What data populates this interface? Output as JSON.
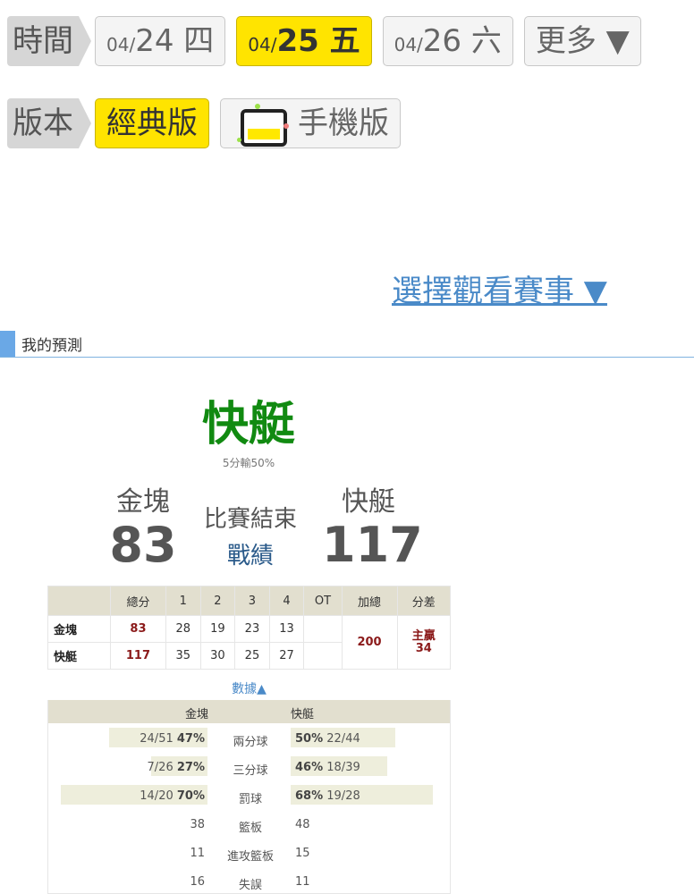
{
  "time_row": {
    "label": "時間",
    "dates": [
      {
        "md": "04/",
        "dd": "24 四",
        "active": false
      },
      {
        "md": "04/",
        "dd": "25 五",
        "active": true
      },
      {
        "md": "04/",
        "dd": "26 六",
        "active": false
      }
    ],
    "more_label": "更多 ▼"
  },
  "version_row": {
    "label": "版本",
    "classic_label": "經典版",
    "mobile_label": "手機版"
  },
  "select_game_label": "選擇觀看賽事 ▼",
  "section": {
    "title": "我的預測"
  },
  "prediction": {
    "team": "快艇",
    "note": "5分輸50%"
  },
  "game": {
    "away": {
      "name": "金塊",
      "score": "83"
    },
    "home": {
      "name": "快艇",
      "score": "117"
    },
    "status": "比賽結束",
    "record_link": "戰績"
  },
  "boxscore": {
    "headers": [
      "",
      "總分",
      "1",
      "2",
      "3",
      "4",
      "OT",
      "加總",
      "分差"
    ],
    "rows": [
      {
        "team": "金塊",
        "total": "83",
        "q": [
          "28",
          "19",
          "23",
          "13"
        ],
        "ot": ""
      },
      {
        "team": "快艇",
        "total": "117",
        "q": [
          "35",
          "30",
          "25",
          "27"
        ],
        "ot": ""
      }
    ],
    "combined": "200",
    "diff_label": "主贏",
    "diff_value": "34"
  },
  "stats_toggle": "數據▲",
  "stats": {
    "away_name": "金塊",
    "home_name": "快艇",
    "rows": [
      {
        "cat": "兩分球",
        "away": "24/51",
        "away_pct": "47%",
        "away_frac": 0.47,
        "home": "22/44",
        "home_pct": "50%",
        "home_frac": 0.5
      },
      {
        "cat": "三分球",
        "away": "7/26",
        "away_pct": "27%",
        "away_frac": 0.27,
        "home": "18/39",
        "home_pct": "46%",
        "home_frac": 0.46
      },
      {
        "cat": "罰球",
        "away": "14/20",
        "away_pct": "70%",
        "away_frac": 0.7,
        "home": "19/28",
        "home_pct": "68%",
        "home_frac": 0.68
      },
      {
        "cat": "籃板",
        "away": "38",
        "home": "48"
      },
      {
        "cat": "進攻籃板",
        "away": "11",
        "home": "15"
      },
      {
        "cat": "失誤",
        "away": "16",
        "home": "11"
      }
    ]
  },
  "colors": {
    "accent_yellow": "#ffe400",
    "prediction_green": "#118a11",
    "link_blue": "#4a8ac8",
    "score_red": "#8b1a1a"
  }
}
